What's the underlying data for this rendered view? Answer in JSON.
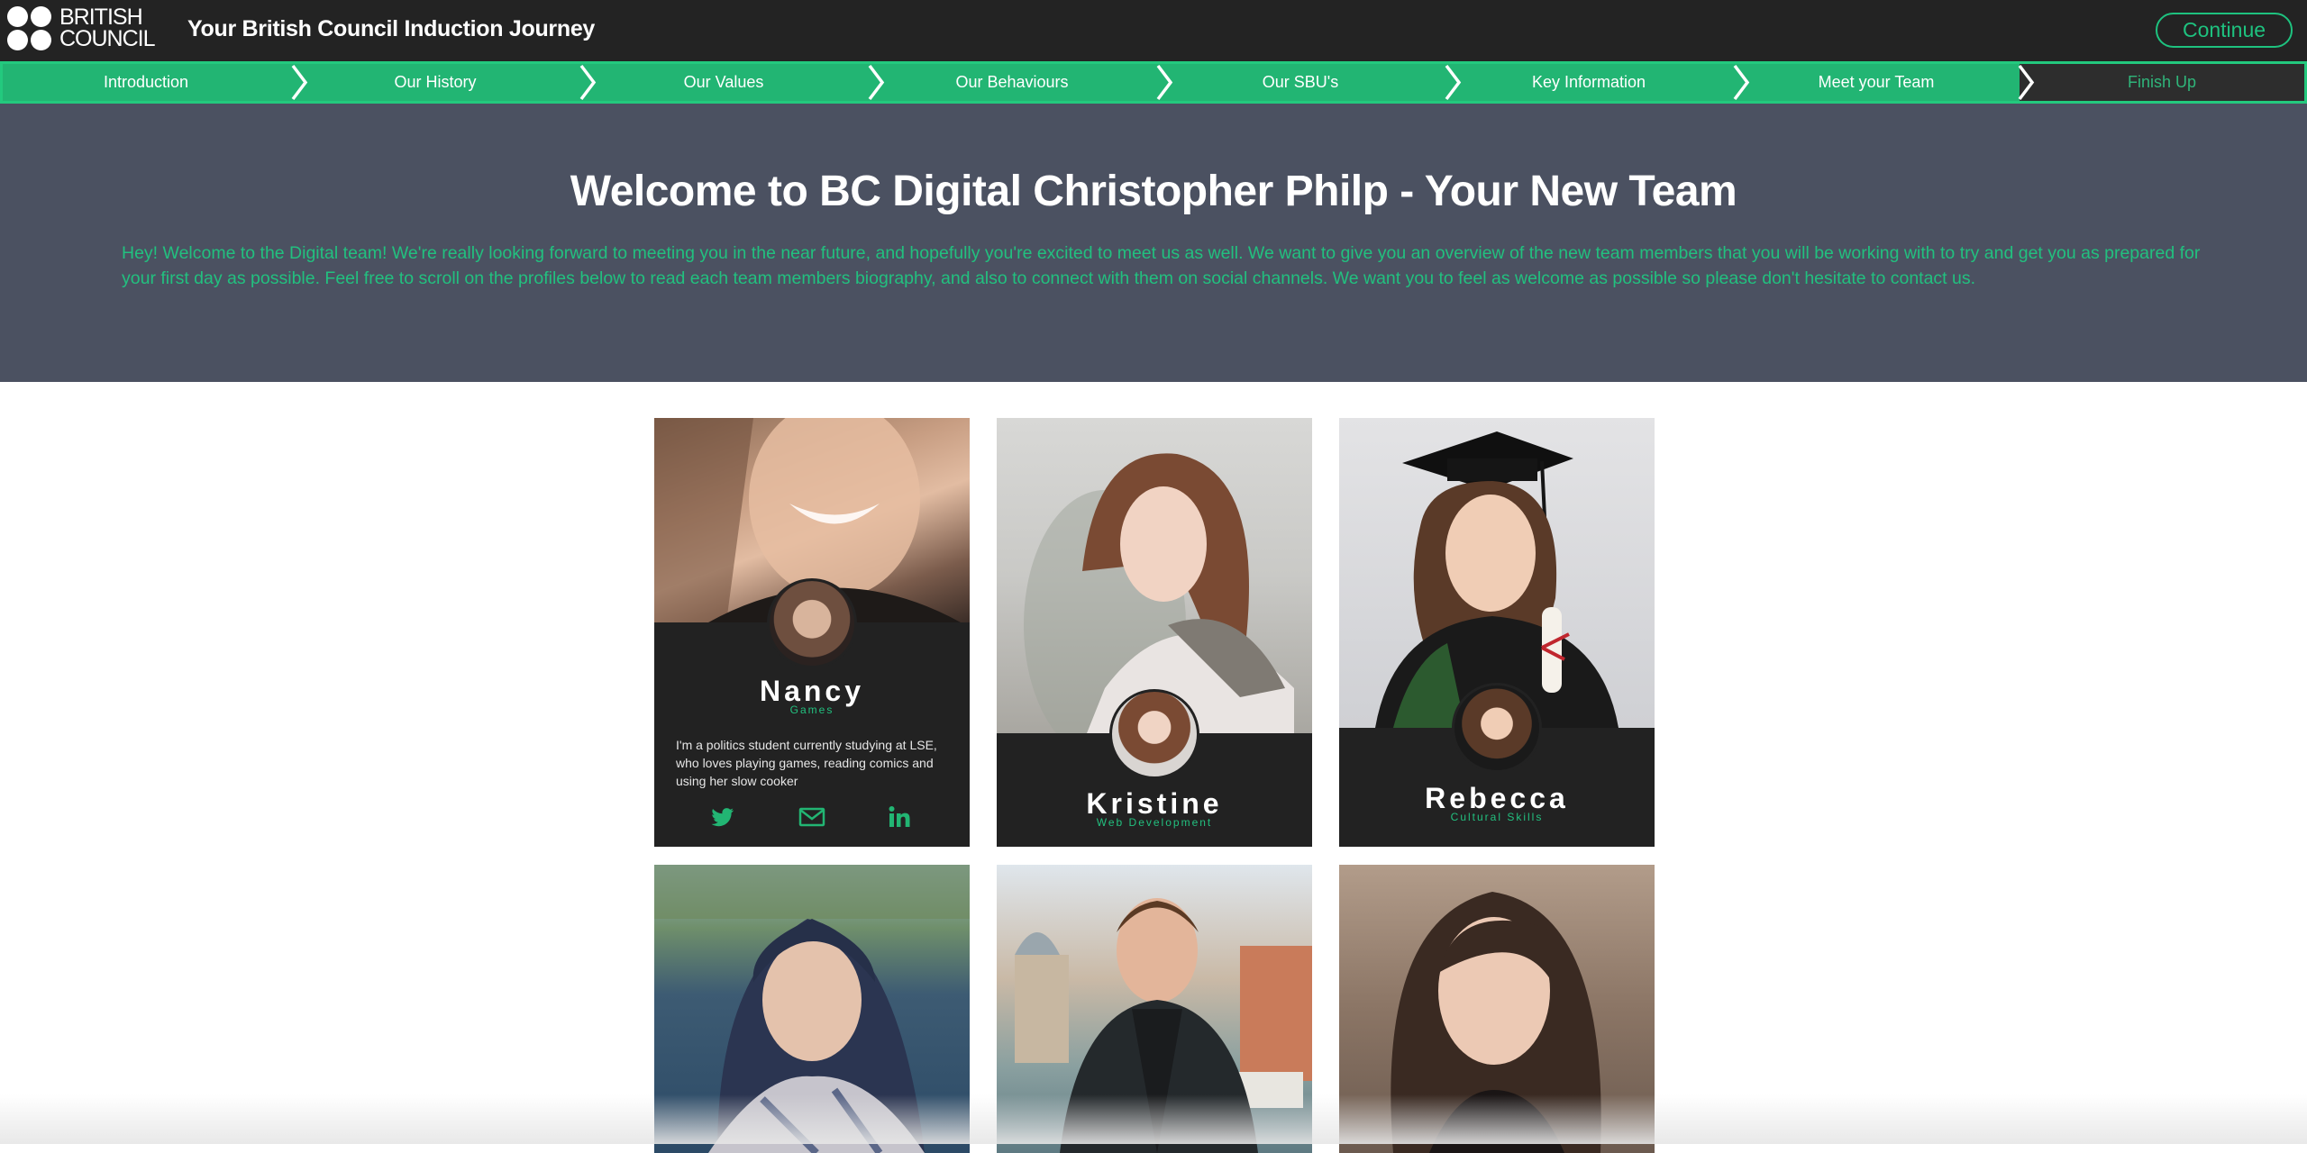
{
  "header": {
    "logo_text": "BRITISH\nCOUNCIL",
    "title": "Your British Council Induction Journey",
    "continue_label": "Continue"
  },
  "steps": [
    {
      "label": "Introduction"
    },
    {
      "label": "Our History"
    },
    {
      "label": "Our Values"
    },
    {
      "label": "Our Behaviours"
    },
    {
      "label": "Our SBU's"
    },
    {
      "label": "Key Information"
    },
    {
      "label": "Meet your Team"
    },
    {
      "label": "Finish Up"
    }
  ],
  "hero": {
    "title": "Welcome to BC Digital Christopher Philp - Your New Team",
    "text": "Hey! Welcome to the Digital team! We're really looking forward to meeting you in the near future, and hopefully you're excited to meet us as well. We want to give you an overview of the new team members that you will be working with to try and get you as prepared for your first day as possible. Feel free to scroll on the profiles below to read each team members biography, and also to connect with them on social channels. We want you to feel as welcome as possible so please don't hesitate to contact us."
  },
  "cards": [
    {
      "name": "Nancy",
      "role": "Games",
      "bio": "I'm a politics student currently studying at LSE, who loves playing games, reading comics and using her slow cooker"
    },
    {
      "name": "Kristine",
      "role": "Web Development"
    },
    {
      "name": "Rebecca",
      "role": "Cultural Skills"
    }
  ],
  "icons": {
    "twitter": "twitter-icon",
    "email": "envelope-icon",
    "linkedin": "linkedin-icon"
  },
  "colors": {
    "accent": "#22b573",
    "accent_text": "#22c07f",
    "header_bg": "#232323",
    "hero_bg": "#4b5161",
    "card_bg": "#222222"
  }
}
